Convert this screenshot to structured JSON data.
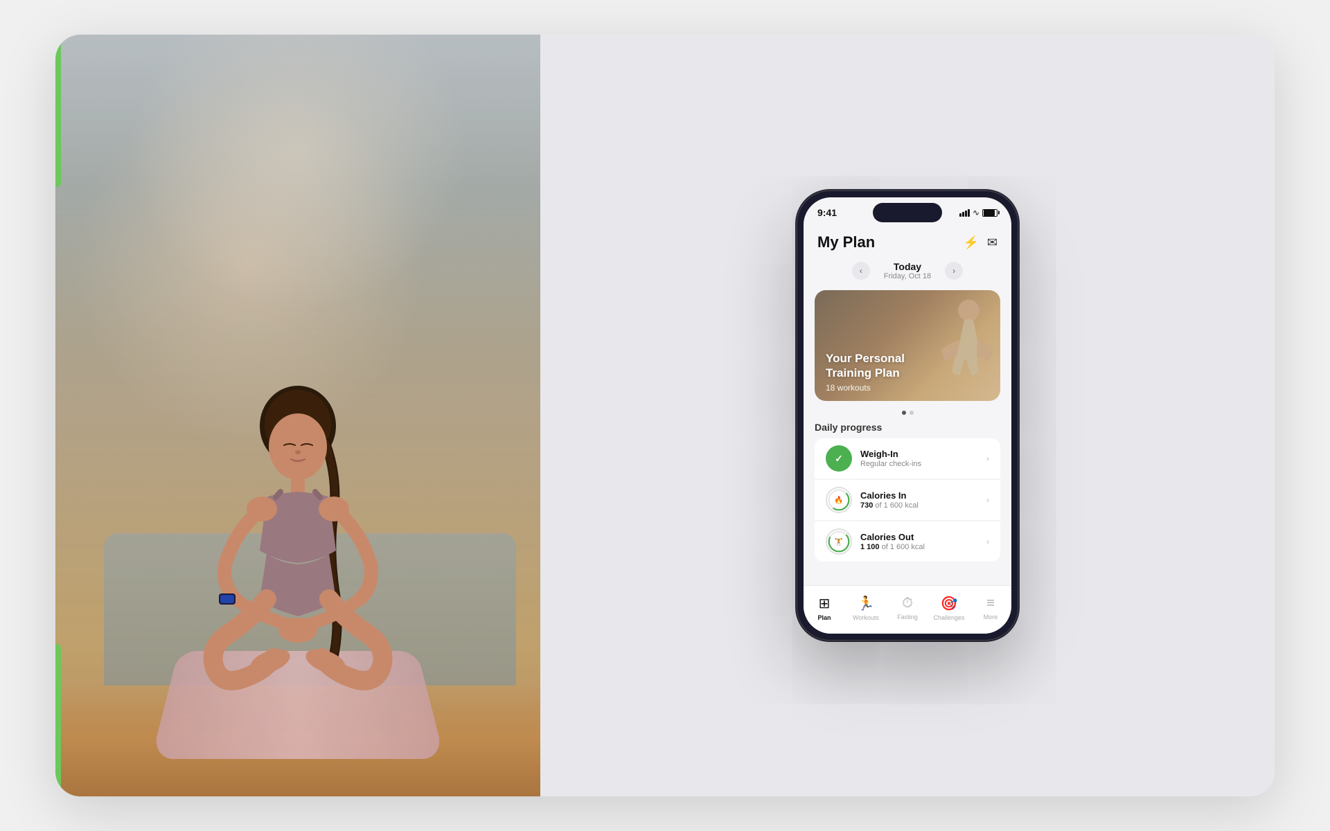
{
  "page": {
    "background_color": "#f0f0f0"
  },
  "photo_side": {
    "alt": "Woman doing yoga on a mat in a living room"
  },
  "app": {
    "status_bar": {
      "time": "9:41",
      "battery_pct": 80
    },
    "header": {
      "title": "My Plan",
      "bolt_icon": "⚡",
      "mail_icon": "✉"
    },
    "date_nav": {
      "label": "Today",
      "sub_label": "Friday, Oct 18",
      "prev_arrow": "‹",
      "next_arrow": "›"
    },
    "banner": {
      "title": "Your Personal\nTraining Plan",
      "subtitle": "18 workouts"
    },
    "dots": [
      {
        "active": true
      },
      {
        "active": false
      }
    ],
    "daily_progress": {
      "section_label": "Daily progress",
      "items": [
        {
          "name": "Weigh-In",
          "sub": "Regular check-ins",
          "type": "completed",
          "icon": "✓"
        },
        {
          "name": "Calories In",
          "sub_prefix": "",
          "sub_bold": "730",
          "sub_suffix": " of 1 600 kcal",
          "type": "ring",
          "icon": "🔥",
          "progress": 45
        },
        {
          "name": "Calories Out",
          "sub_prefix": "",
          "sub_bold": "1 100",
          "sub_suffix": " of 1 600 kcal",
          "type": "ring",
          "icon": "🏋",
          "progress": 68
        }
      ]
    },
    "bottom_nav": {
      "items": [
        {
          "label": "Plan",
          "icon": "▦",
          "active": true
        },
        {
          "label": "Workouts",
          "icon": "🏃",
          "active": false
        },
        {
          "label": "Fasting",
          "icon": "⏱",
          "active": false
        },
        {
          "label": "Challenges",
          "icon": "🎯",
          "active": false
        },
        {
          "label": "More",
          "icon": "≡",
          "active": false
        }
      ]
    }
  }
}
